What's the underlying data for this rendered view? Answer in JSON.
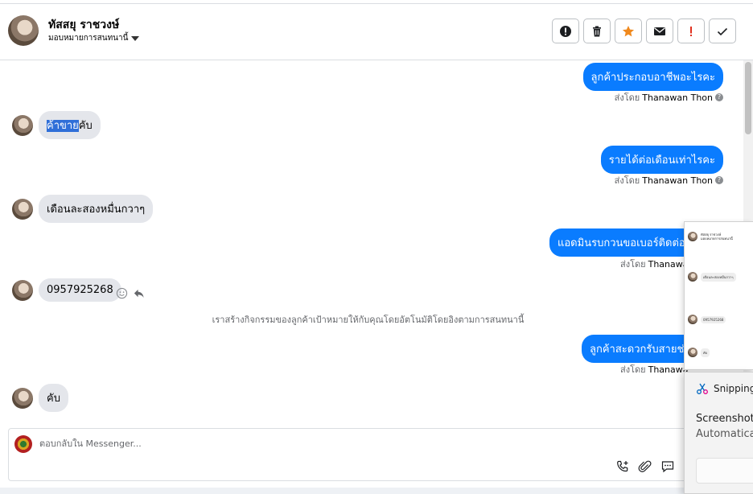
{
  "header": {
    "contact_name": "ทัสสยุ ราชวงษ์",
    "assign_label": "มอบหมายการสนทนานี้",
    "actions": [
      {
        "name": "report-icon",
        "label": "!"
      },
      {
        "name": "trash-icon",
        "label": ""
      },
      {
        "name": "star-icon",
        "label": ""
      },
      {
        "name": "envelope-icon",
        "label": ""
      },
      {
        "name": "important-icon",
        "label": "!"
      },
      {
        "name": "check-icon",
        "label": ""
      }
    ],
    "star_color": "#f0891d",
    "important_color": "#e0301e"
  },
  "messages": {
    "out1": {
      "text": "ลูกค้าประกอบอาชีพอะไรคะ",
      "sent_prefix": "ส่งโดย",
      "sender": "Thanawan Thon"
    },
    "in1": {
      "highlight": "ค้าขาย",
      "rest": "คับ"
    },
    "out2": {
      "text": "รายได้ต่อเดือนเท่าไรคะ",
      "sent_prefix": "ส่งโดย",
      "sender": "Thanawan Thon"
    },
    "in2": {
      "text": "เดือนละสองหมื่นกวาๆ"
    },
    "out3": {
      "text": "แอดมินรบกวนขอเบอร์ติดต่อได้",
      "sent_prefix": "ส่งโดย",
      "sender": "Thanawa"
    },
    "in3": {
      "text": "0957925268"
    },
    "system": "เราสร้างกิจกรรมของลูกค้าเป้าหมายให้กับคุณโดยอัตโนมัติโดยอิงตามการสนทนานี้",
    "out4": {
      "text": "ลูกค้าสะดวกรับสายช่วง",
      "sent_prefix": "ส่งโดย",
      "sender": "Thanawa"
    },
    "in4": {
      "text": "คับ"
    }
  },
  "composer": {
    "placeholder": "ตอบกลับใน Messenger..."
  },
  "thumbnail": {
    "name": "ทัสสยุ ราชวงษ์",
    "sub": "มอบหมายการสนทนานี้",
    "rows": [
      "เดือนละสองหมื่นกวาๆ",
      "0957925268",
      "คับ"
    ]
  },
  "snip_notification": {
    "app": "Snipping",
    "title": "Screenshot",
    "body": "Automatica"
  },
  "colors": {
    "outgoing_bubble": "#0a7cff",
    "incoming_bubble": "#e4e6eb"
  }
}
